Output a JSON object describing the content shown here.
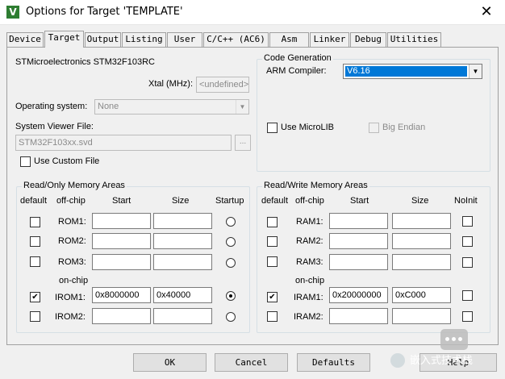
{
  "window": {
    "title": "Options for Target 'TEMPLATE'",
    "icon": "keil-uvision-icon",
    "close": "✕"
  },
  "tabs": [
    {
      "label": "Device",
      "active": false
    },
    {
      "label": "Target",
      "active": true
    },
    {
      "label": "Output",
      "active": false
    },
    {
      "label": "Listing",
      "active": false
    },
    {
      "label": "User",
      "active": false
    },
    {
      "label": "C/C++ (AC6)",
      "active": false
    },
    {
      "label": "Asm",
      "active": false
    },
    {
      "label": "Linker",
      "active": false
    },
    {
      "label": "Debug",
      "active": false
    },
    {
      "label": "Utilities",
      "active": false
    }
  ],
  "target": {
    "device": "STMicroelectronics STM32F103RC",
    "xtal_label": "Xtal (MHz):",
    "xtal_value": "<undefined>",
    "os_label": "Operating system:",
    "os_value": "None",
    "svd_label": "System Viewer File:",
    "svd_value": "STM32F103xx.svd",
    "svd_browse": "...",
    "custom_file_label": "Use Custom File",
    "custom_file_checked": false
  },
  "codegen": {
    "title": "Code Generation",
    "compiler_label": "ARM Compiler:",
    "compiler_value": "V6.16",
    "microlib_label": "Use MicroLIB",
    "microlib_checked": false,
    "bigendian_label": "Big Endian",
    "bigendian_checked": false
  },
  "rom": {
    "title": "Read/Only Memory Areas",
    "headers": {
      "default": "default",
      "offchip": "off-chip",
      "start": "Start",
      "size": "Size",
      "startup": "Startup"
    },
    "onchip_label": "on-chip",
    "rows": [
      {
        "label": "ROM1:",
        "default": false,
        "start": "",
        "size": "",
        "startup": false
      },
      {
        "label": "ROM2:",
        "default": false,
        "start": "",
        "size": "",
        "startup": false
      },
      {
        "label": "ROM3:",
        "default": false,
        "start": "",
        "size": "",
        "startup": false
      },
      {
        "label": "IROM1:",
        "default": true,
        "start": "0x8000000",
        "size": "0x40000",
        "startup": true
      },
      {
        "label": "IROM2:",
        "default": false,
        "start": "",
        "size": "",
        "startup": false
      }
    ]
  },
  "ram": {
    "title": "Read/Write Memory Areas",
    "headers": {
      "default": "default",
      "offchip": "off-chip",
      "start": "Start",
      "size": "Size",
      "noinit": "NoInit"
    },
    "onchip_label": "on-chip",
    "rows": [
      {
        "label": "RAM1:",
        "default": false,
        "start": "",
        "size": "",
        "noinit": false
      },
      {
        "label": "RAM2:",
        "default": false,
        "start": "",
        "size": "",
        "noinit": false
      },
      {
        "label": "RAM3:",
        "default": false,
        "start": "",
        "size": "",
        "noinit": false
      },
      {
        "label": "IRAM1:",
        "default": true,
        "start": "0x20000000",
        "size": "0xC000",
        "noinit": false
      },
      {
        "label": "IRAM2:",
        "default": false,
        "start": "",
        "size": "",
        "noinit": false
      }
    ]
  },
  "buttons": {
    "ok": "OK",
    "cancel": "Cancel",
    "defaults": "Defaults",
    "help": "Help"
  },
  "watermark": {
    "text": "嵌入式技术栈"
  },
  "colors": {
    "selection": "#0078d7",
    "disabled_text": "#8a8a8a"
  }
}
